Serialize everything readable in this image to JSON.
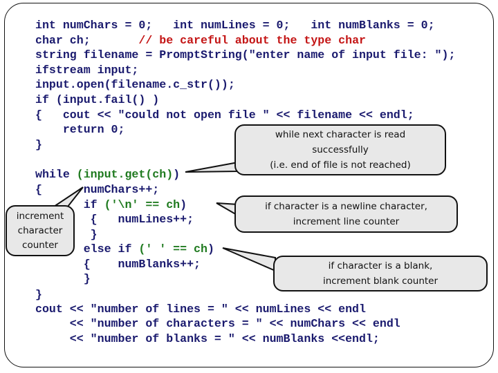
{
  "code_lines": [
    {
      "indent": 0,
      "tokens": [
        {
          "t": "int numChars = 0;   int numLines = 0;   int numBlanks = 0;",
          "c": "blue"
        }
      ]
    },
    {
      "indent": 0,
      "tokens": [
        {
          "t": "char ch;       ",
          "c": "blue"
        },
        {
          "t": "// be careful about the type char",
          "c": "red"
        }
      ]
    },
    {
      "indent": 0,
      "tokens": [
        {
          "t": "string filename = PromptString(\"enter name of input file: \");",
          "c": "blue"
        }
      ]
    },
    {
      "indent": 0,
      "tokens": [
        {
          "t": "ifstream input;",
          "c": "blue"
        }
      ]
    },
    {
      "indent": 0,
      "tokens": [
        {
          "t": "input.open(filename.c_str());",
          "c": "blue"
        }
      ]
    },
    {
      "indent": 0,
      "tokens": [
        {
          "t": "if (input.fail() )",
          "c": "blue"
        }
      ]
    },
    {
      "indent": 0,
      "tokens": [
        {
          "t": "{   cout << \"could not open file \" << filename << endl;",
          "c": "blue"
        }
      ]
    },
    {
      "indent": 0,
      "tokens": [
        {
          "t": "    return 0;",
          "c": "blue"
        }
      ]
    },
    {
      "indent": 0,
      "tokens": [
        {
          "t": "}",
          "c": "blue"
        }
      ]
    },
    {
      "indent": 0,
      "tokens": []
    },
    {
      "indent": 0,
      "tokens": [
        {
          "t": "while ",
          "c": "blue"
        },
        {
          "t": "(input.get(ch)",
          "c": "green"
        },
        {
          "t": ")",
          "c": "blue"
        }
      ]
    },
    {
      "indent": 0,
      "tokens": [
        {
          "t": "{      numChars++;",
          "c": "blue"
        }
      ]
    },
    {
      "indent": 0,
      "tokens": [
        {
          "t": "       if ",
          "c": "blue"
        },
        {
          "t": "('\\n' == ch",
          "c": "green"
        },
        {
          "t": ")",
          "c": "blue"
        }
      ]
    },
    {
      "indent": 0,
      "tokens": [
        {
          "t": "        {   numLines++;",
          "c": "blue"
        }
      ]
    },
    {
      "indent": 0,
      "tokens": [
        {
          "t": "        }",
          "c": "blue"
        }
      ]
    },
    {
      "indent": 0,
      "tokens": [
        {
          "t": "       else if ",
          "c": "blue"
        },
        {
          "t": "(' ' == ch",
          "c": "green"
        },
        {
          "t": ")",
          "c": "blue"
        }
      ]
    },
    {
      "indent": 0,
      "tokens": [
        {
          "t": "       {    numBlanks++;",
          "c": "blue"
        }
      ]
    },
    {
      "indent": 0,
      "tokens": [
        {
          "t": "       }",
          "c": "blue"
        }
      ]
    },
    {
      "indent": 0,
      "tokens": [
        {
          "t": "}",
          "c": "blue"
        }
      ]
    },
    {
      "indent": 0,
      "tokens": [
        {
          "t": "cout << \"number of lines = \" << numLines << endl",
          "c": "blue"
        }
      ]
    },
    {
      "indent": 0,
      "tokens": [
        {
          "t": "     << \"number of characters = \" << numChars << endl",
          "c": "blue"
        }
      ]
    },
    {
      "indent": 0,
      "tokens": [
        {
          "t": "     << \"number of blanks = \" << numBlanks <<endl;",
          "c": "blue"
        }
      ]
    }
  ],
  "callouts": {
    "while_read": [
      "while next character is read",
      "successfully",
      "(i.e. end of file is not reached)"
    ],
    "newline": [
      "if character is a newline character,",
      "increment line counter"
    ],
    "blank": [
      "if character is a blank,",
      "increment blank counter"
    ],
    "char_counter": [
      "increment",
      "character",
      "counter"
    ]
  },
  "colors": {
    "keyword_blue": "#1a1a6e",
    "condition_green": "#1f7a1f",
    "comment_red": "#c41616",
    "callout_fill": "#e8e8e8"
  }
}
